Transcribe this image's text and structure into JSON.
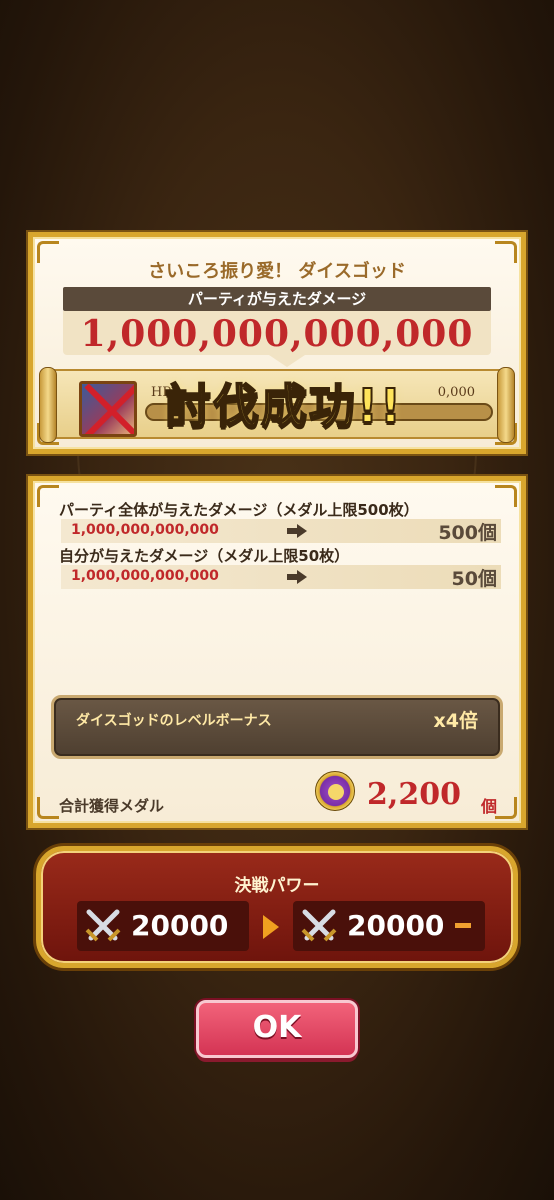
{
  "banner": {
    "event_title": "さいころ振り愛！ ダイスゴッド",
    "damage_header": "パーティが与えたダメージ",
    "damage_value": "1,000,000,000,000",
    "hp_label": "HP",
    "hp_remaining": "0,000",
    "result_text": "討伐成功!!",
    "boss_defeated": true
  },
  "medals": {
    "rows": [
      {
        "label": "パーティ全体が与えたダメージ（メダル上限500枚）",
        "damage": "1,000,000,000,000",
        "medals": "500個"
      },
      {
        "label": "自分が与えたダメージ（メダル上限50枚）",
        "damage": "1,000,000,000,000",
        "medals": "50個"
      }
    ],
    "bonus_label": "ダイスゴッドのレベルボーナス",
    "bonus_multiplier": "x4倍",
    "total_label": "合計獲得メダル",
    "total_value": "2,200",
    "total_unit": "個"
  },
  "power": {
    "title": "決戦パワー",
    "before": "20000",
    "after": "20000",
    "icon": "crossed-swords-icon"
  },
  "ok_label": "OK",
  "colors": {
    "damage_red": "#c0282a",
    "gold_frame": "#d8a62d",
    "ok_pink": "#e04a66"
  }
}
